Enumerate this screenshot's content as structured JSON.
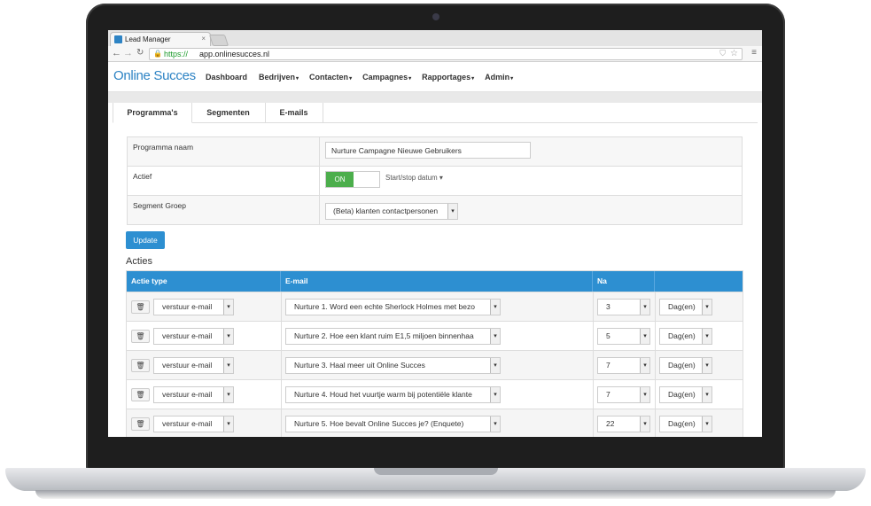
{
  "browser": {
    "tab_title": "Lead Manager",
    "tab_close": "×",
    "url_scheme": "https://",
    "url_host": "app.onlinesucces.nl"
  },
  "app": {
    "logo": "Online Succes",
    "nav": [
      {
        "label": "Dashboard",
        "caret": ""
      },
      {
        "label": "Bedrijven",
        "caret": "▾"
      },
      {
        "label": "Contacten",
        "caret": "▾"
      },
      {
        "label": "Campagnes",
        "caret": "▾"
      },
      {
        "label": "Rapportages",
        "caret": "▾"
      },
      {
        "label": "Admin",
        "caret": "▾"
      }
    ]
  },
  "tabs": [
    "Programma's",
    "Segmenten",
    "E-mails"
  ],
  "settings": {
    "name_label": "Programma naam",
    "name_value": "Nurture Campagne Nieuwe Gebruikers",
    "active_label": "Actief",
    "toggle_on": "ON",
    "startstop": "Start/stop datum ▾",
    "segment_label": "Segment Groep",
    "segment_value": "(Beta) klanten contactpersonen"
  },
  "update_label": "Update",
  "acties_title": "Acties",
  "actions": {
    "headers": [
      "Actie type",
      "E-mail",
      "Na",
      ""
    ],
    "rows": [
      {
        "type": "verstuur e-mail",
        "email": "Nurture 1. Word een echte Sherlock Holmes met bezo",
        "na": "3",
        "unit": "Dag(en)"
      },
      {
        "type": "verstuur e-mail",
        "email": "Nurture 2. Hoe een klant ruim E1,5 miljoen binnenhaa",
        "na": "5",
        "unit": "Dag(en)"
      },
      {
        "type": "verstuur e-mail",
        "email": "Nurture 3. Haal meer uit Online Succes",
        "na": "7",
        "unit": "Dag(en)"
      },
      {
        "type": "verstuur e-mail",
        "email": "Nurture 4. Houd het vuurtje warm bij potentiële klante",
        "na": "7",
        "unit": "Dag(en)"
      },
      {
        "type": "verstuur e-mail",
        "email": "Nurture 5. Hoe bevalt Online Succes je? (Enquete)",
        "na": "22",
        "unit": "Dag(en)"
      }
    ]
  },
  "icons": {
    "select_arrow": "▾",
    "trash": "🗑"
  }
}
